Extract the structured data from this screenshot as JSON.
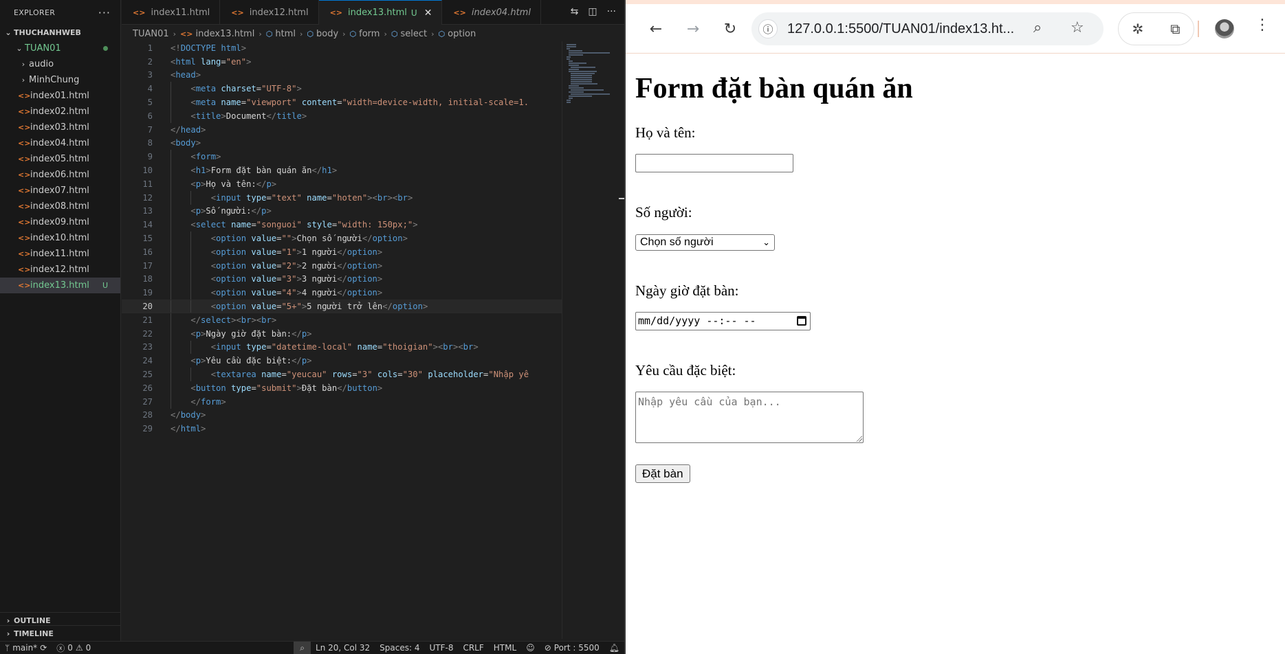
{
  "explorer": {
    "title": "EXPLORER",
    "more": "···",
    "workspace": "THUCHANHWEB",
    "folder": "TUAN01",
    "subfolders": [
      "audio",
      "MinhChung"
    ],
    "files": [
      {
        "name": "index01.html"
      },
      {
        "name": "index02.html"
      },
      {
        "name": "index03.html"
      },
      {
        "name": "index04.html"
      },
      {
        "name": "index05.html"
      },
      {
        "name": "index06.html"
      },
      {
        "name": "index07.html"
      },
      {
        "name": "index08.html"
      },
      {
        "name": "index09.html"
      },
      {
        "name": "index10.html"
      },
      {
        "name": "index11.html"
      },
      {
        "name": "index12.html"
      },
      {
        "name": "index13.html",
        "badge": "U"
      }
    ],
    "outline": "OUTLINE",
    "timeline": "TIMELINE"
  },
  "tabs": [
    {
      "label": "index11.html"
    },
    {
      "label": "index12.html"
    },
    {
      "label": "index13.html",
      "badge": "U",
      "active": true
    },
    {
      "label": "index04.html",
      "italic": true
    }
  ],
  "breadcrumb": [
    "TUAN01",
    "index13.html",
    "html",
    "body",
    "form",
    "select",
    "option"
  ],
  "code_lines": [
    "<!DOCTYPE html>",
    "<html lang=\"en\">",
    "<head>",
    "    <meta charset=\"UTF-8\">",
    "    <meta name=\"viewport\" content=\"width=device-width, initial-scale=1.",
    "    <title>Document</title>",
    "</head>",
    "<body>",
    "    <form>",
    "    <h1>Form đặt bàn quán ăn</h1>",
    "    <p>Họ và tên:</p>",
    "        <input type=\"text\" name=\"hoten\"><br><br>",
    "    <p>Số người:</p>",
    "    <select name=\"songuoi\" style=\"width: 150px;\">",
    "        <option value=\"\">Chọn số người</option>",
    "        <option value=\"1\">1 người</option>",
    "        <option value=\"2\">2 người</option>",
    "        <option value=\"3\">3 người</option>",
    "        <option value=\"4\">4 người</option>",
    "        <option value=\"5+\">5 người trở lên</option>",
    "    </select><br><br>",
    "    <p>Ngày giờ đặt bàn:</p>",
    "        <input type=\"datetime-local\" name=\"thoigian\"><br><br>",
    "    <p>Yêu cầu đặc biệt:</p>",
    "        <textarea name=\"yeucau\" rows=\"3\" cols=\"30\" placeholder=\"Nhập yê",
    "    <button type=\"submit\">Đặt bàn</button>",
    "    </form>",
    "</body>",
    "</html>"
  ],
  "current_line": 20,
  "status": {
    "branch": "main*",
    "errors": "0",
    "warnings": "0",
    "position": "Ln 20, Col 32",
    "spaces": "Spaces: 4",
    "encoding": "UTF-8",
    "eol": "CRLF",
    "language": "HTML",
    "port": "Port : 5500"
  },
  "browser": {
    "url": "127.0.0.1:5500/TUAN01/index13.ht...",
    "page": {
      "heading": "Form đặt bàn quán ăn",
      "name_label": "Họ và tên:",
      "people_label": "Số người:",
      "people_selected": "Chọn số người",
      "datetime_label": "Ngày giờ đặt bàn:",
      "datetime_placeholder": "mm/dd/yyyy --:-- --",
      "request_label": "Yêu cầu đặc biệt:",
      "request_placeholder": "Nhập yêu cầu của bạn...",
      "submit_label": "Đặt bàn"
    }
  }
}
